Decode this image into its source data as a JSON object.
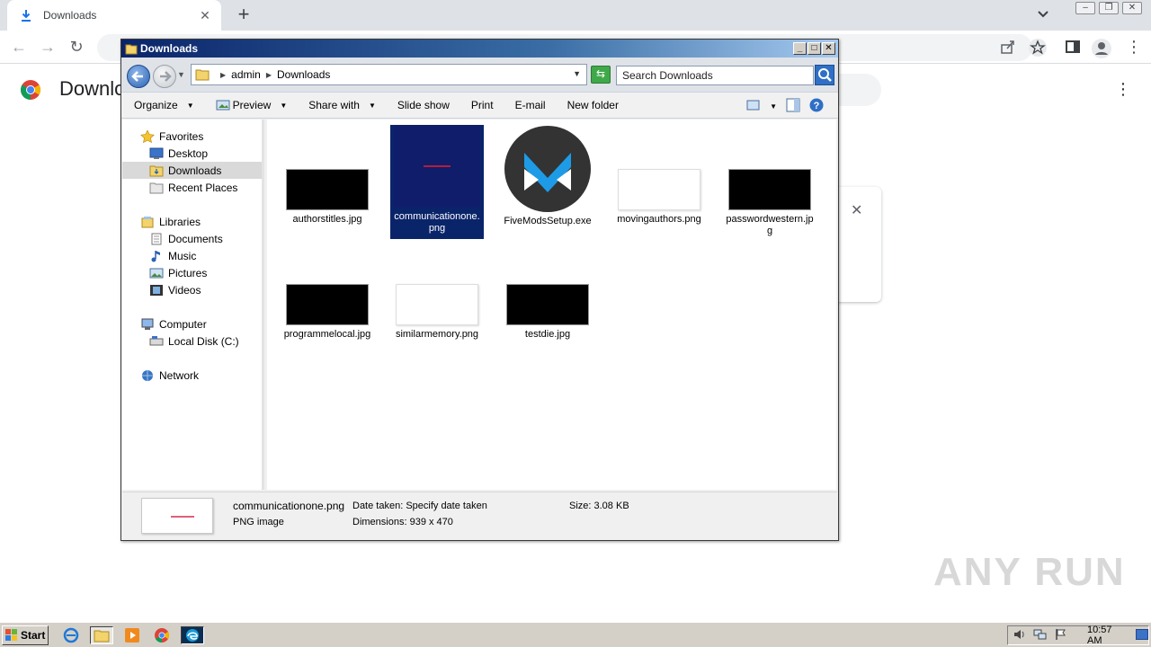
{
  "browser": {
    "tab_title": "Downloads",
    "tab_close": "✕",
    "new_tab": "+",
    "page_title": "Downloads",
    "card_close": "✕",
    "watermark": "ANY RUN"
  },
  "explorer": {
    "window_title": "Downloads",
    "min": "_",
    "max": "□",
    "close": "✕",
    "breadcrumb": [
      "admin",
      "Downloads"
    ],
    "search_placeholder": "Search Downloads",
    "commands": {
      "organize": "Organize",
      "preview": "Preview",
      "share_with": "Share with",
      "slide_show": "Slide show",
      "print": "Print",
      "email": "E-mail",
      "new_folder": "New folder"
    },
    "nav": {
      "favorites": "Favorites",
      "desktop": "Desktop",
      "downloads": "Downloads",
      "recent_places": "Recent Places",
      "libraries": "Libraries",
      "documents": "Documents",
      "music": "Music",
      "pictures": "Pictures",
      "videos": "Videos",
      "computer": "Computer",
      "local_disk": "Local Disk (C:)",
      "network": "Network"
    },
    "files": [
      {
        "name": "authorstitles.jpg"
      },
      {
        "name": "communicationone.png",
        "selected": true
      },
      {
        "name": "FiveModsSetup.exe"
      },
      {
        "name": "movingauthors.png"
      },
      {
        "name": "passwordwestern.jpg"
      },
      {
        "name": "programmelocal.jpg"
      },
      {
        "name": "similarmemory.png"
      },
      {
        "name": "testdie.jpg"
      }
    ],
    "details": {
      "filename": "communicationone.png",
      "type": "PNG image",
      "date_taken": "Date taken: Specify date taken",
      "dimensions": "Dimensions: 939 x 470",
      "size": "Size: 3.08 KB"
    }
  },
  "taskbar": {
    "start": "Start",
    "clock": "10:57 AM"
  },
  "colors": {
    "selection": "#0a246a",
    "titlebar": "#0a246a",
    "taskbar": "#d4d0c8",
    "accent_blue": "#2f6fc6"
  }
}
